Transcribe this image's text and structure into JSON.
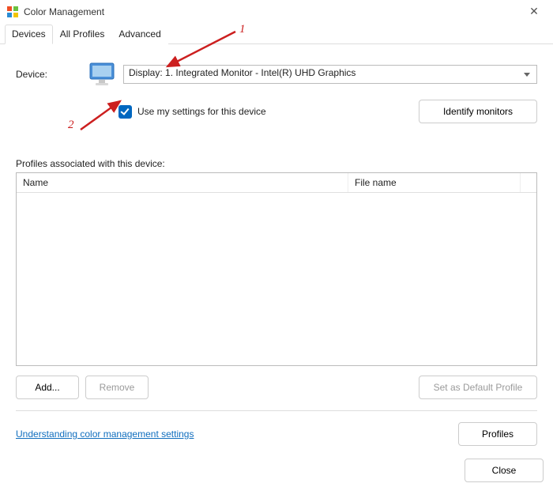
{
  "window": {
    "title": "Color Management"
  },
  "tabs": {
    "devices": "Devices",
    "all_profiles": "All Profiles",
    "advanced": "Advanced"
  },
  "device": {
    "label": "Device:",
    "selected": "Display: 1. Integrated Monitor - Intel(R) UHD Graphics"
  },
  "use_settings_label": "Use my settings for this device",
  "identify_label": "Identify monitors",
  "profiles": {
    "label": "Profiles associated with this device:",
    "col_name": "Name",
    "col_file": "File name"
  },
  "buttons": {
    "add": "Add...",
    "remove": "Remove",
    "set_default": "Set as Default Profile",
    "profiles": "Profiles",
    "close": "Close"
  },
  "link_text": "Understanding color management settings",
  "annotations": {
    "one": "1",
    "two": "2"
  }
}
